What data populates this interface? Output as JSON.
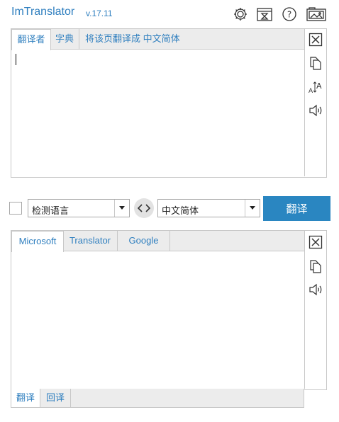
{
  "header": {
    "title": "ImTranslator",
    "version": "v.17.11",
    "icons": [
      "settings-icon",
      "history-icon",
      "help-icon",
      "screenshot-icon"
    ]
  },
  "source_panel": {
    "tabs": [
      {
        "label": "翻译者",
        "active": true
      },
      {
        "label": "字典",
        "active": false
      },
      {
        "label": "将该页翻译成 中文简体",
        "active": false
      }
    ],
    "text": "",
    "side_icons": [
      "clear-icon",
      "copy-icon",
      "font-size-icon",
      "speaker-icon"
    ]
  },
  "controls": {
    "detect_checkbox_checked": false,
    "source_language": "检测语言",
    "target_language": "中文简体",
    "swap_icon": "swap-icon",
    "translate_label": "翻译"
  },
  "result_panel": {
    "tabs": [
      {
        "label": "Microsoft",
        "active": true
      },
      {
        "label": "Translator",
        "active": false
      },
      {
        "label": "Google",
        "active": false
      }
    ],
    "text": "",
    "side_icons": [
      "clear-icon",
      "copy-icon",
      "speaker-icon"
    ],
    "bottom_tabs": [
      {
        "label": "翻译",
        "active": true
      },
      {
        "label": "回译",
        "active": false
      }
    ]
  },
  "colors": {
    "accent": "#2a86c1",
    "link": "#2f7fbf",
    "border": "#c8c8c8",
    "tabbar": "#ececec"
  }
}
